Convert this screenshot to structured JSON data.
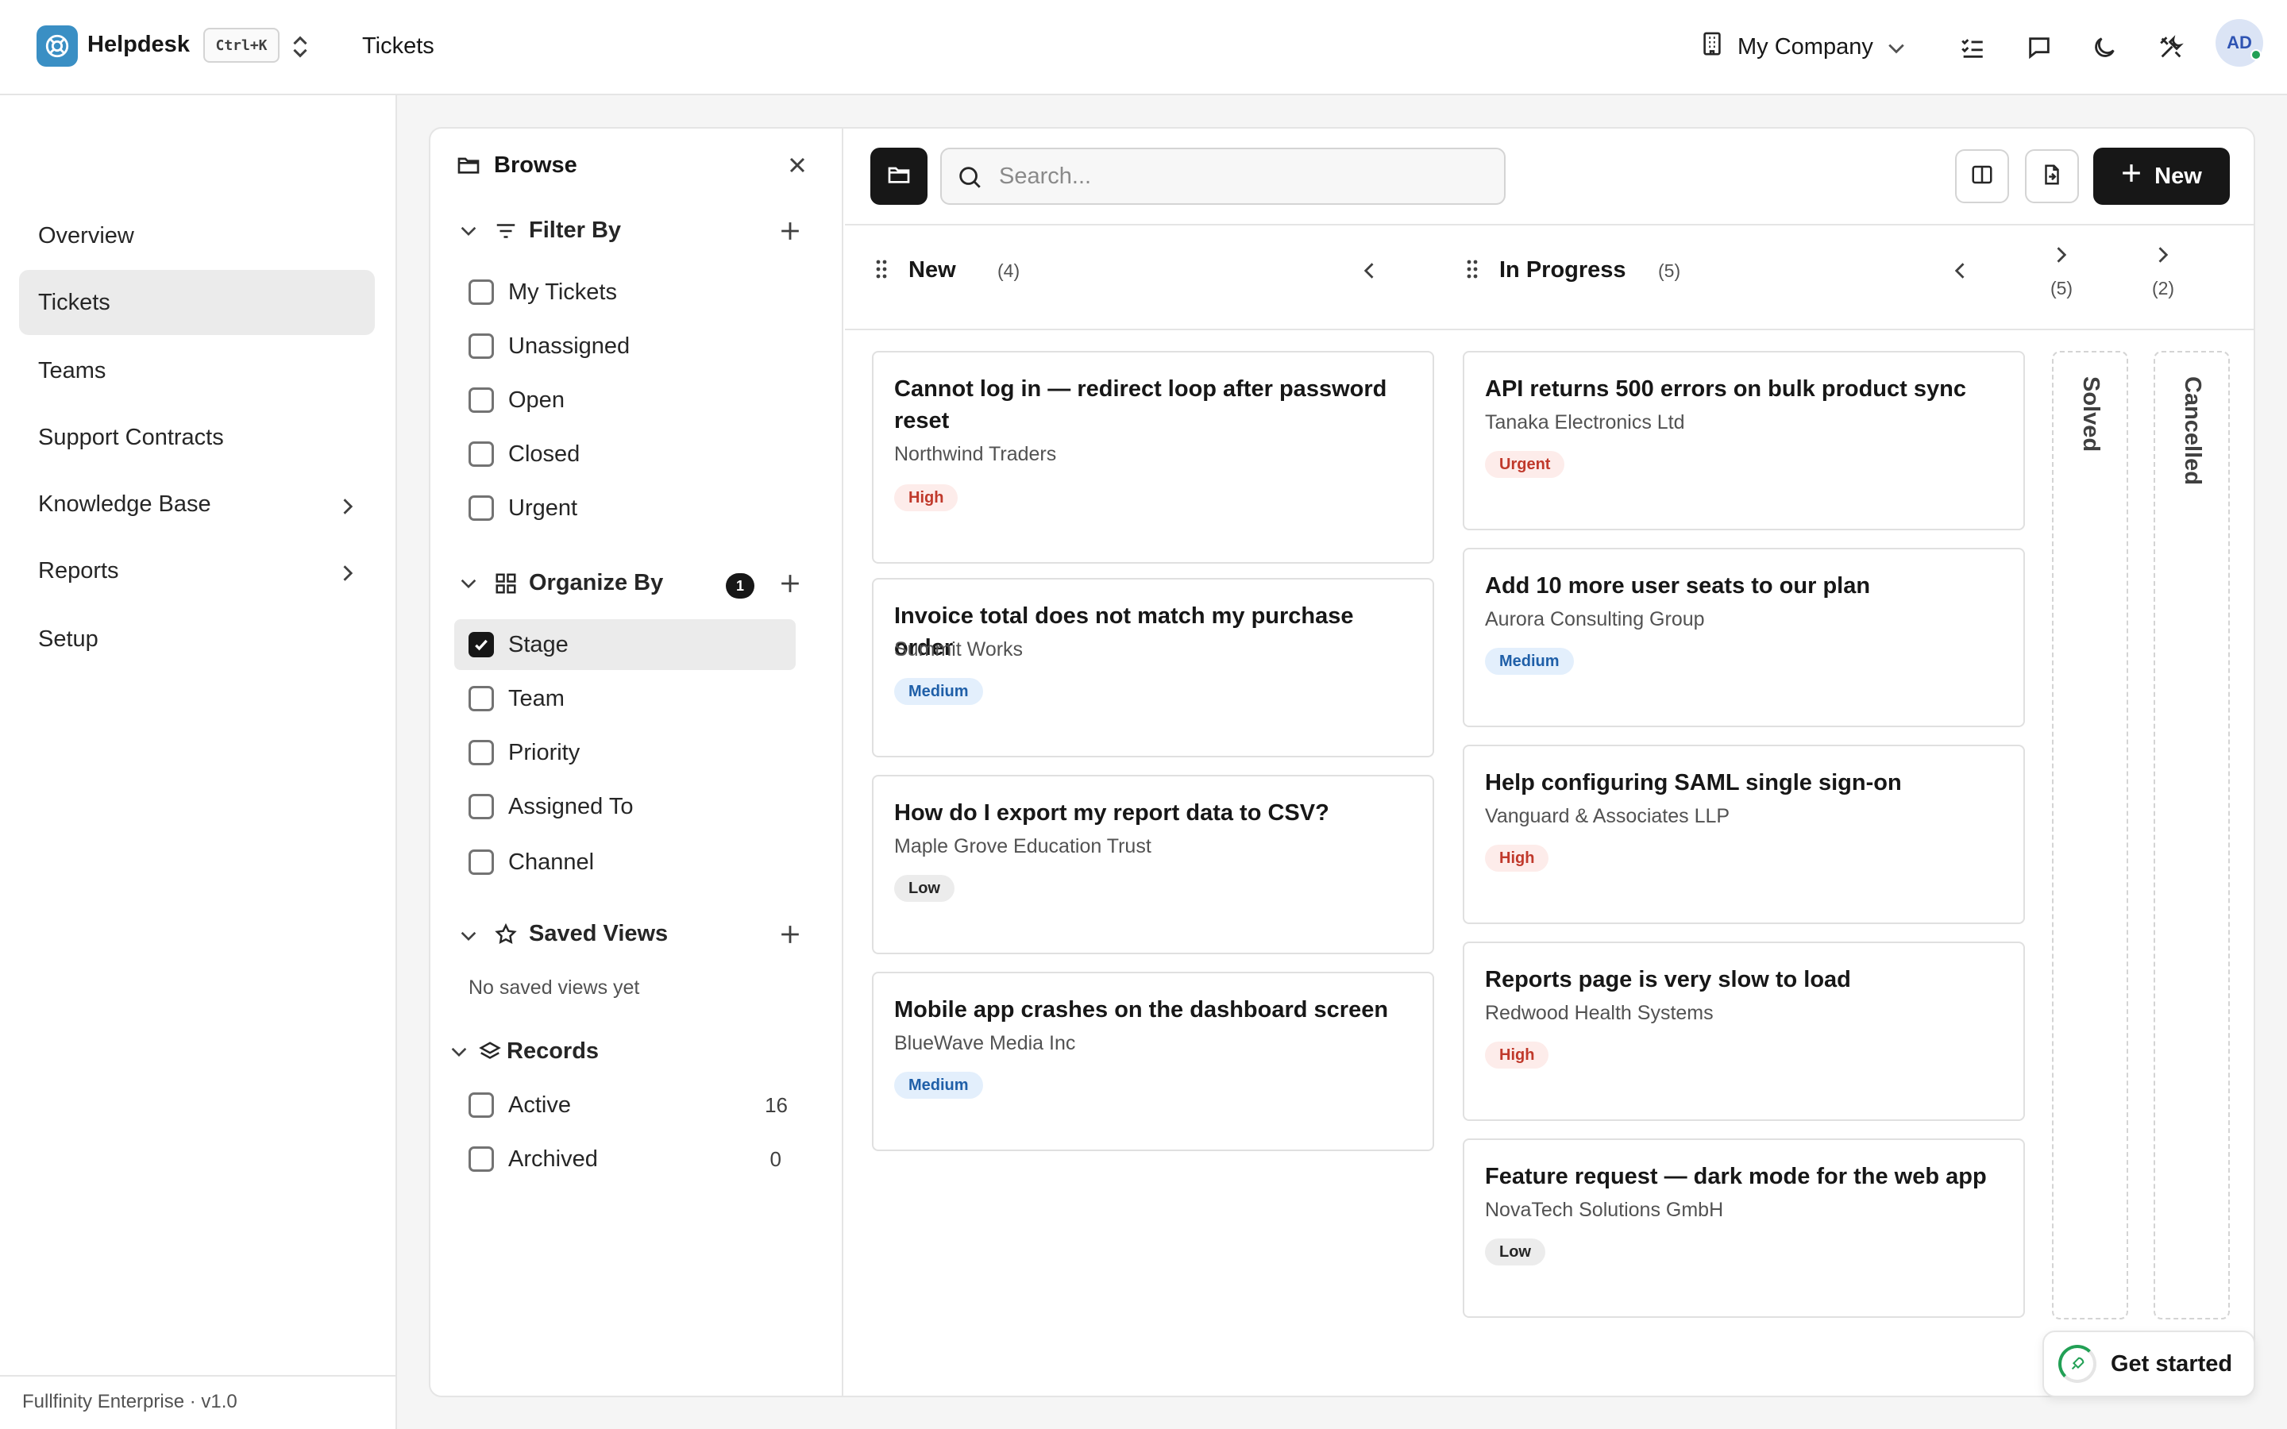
{
  "app": {
    "name": "Helpdesk",
    "shortcut": "Ctrl+K",
    "breadcrumb": "Tickets",
    "company": "My Company",
    "avatar_initials": "AD"
  },
  "sidebar": {
    "items": [
      {
        "label": "Overview"
      },
      {
        "label": "Tickets",
        "active": true
      },
      {
        "label": "Teams"
      },
      {
        "label": "Support Contracts"
      },
      {
        "label": "Knowledge Base"
      },
      {
        "label": "Reports"
      },
      {
        "label": "Setup"
      }
    ],
    "footer": "Fullfinity Enterprise · v1.0"
  },
  "browse": {
    "title": "Browse",
    "filter_by": {
      "title": "Filter By",
      "options": [
        "My Tickets",
        "Unassigned",
        "Open",
        "Closed",
        "Urgent"
      ]
    },
    "organize_by": {
      "title": "Organize By",
      "badge": "1",
      "options": [
        "Stage",
        "Team",
        "Priority",
        "Assigned To",
        "Channel"
      ],
      "selected": "Stage"
    },
    "saved_views": {
      "title": "Saved Views",
      "empty": "No saved views yet"
    },
    "records": {
      "title": "Records",
      "items": [
        {
          "label": "Active",
          "count": "16"
        },
        {
          "label": "Archived",
          "count": "0"
        }
      ]
    }
  },
  "toolbar": {
    "search_placeholder": "Search...",
    "new_label": "New"
  },
  "columns": [
    {
      "title": "New",
      "count": "(4)",
      "cards": [
        {
          "title": "Cannot log in — redirect loop after password reset",
          "org": "Northwind Traders",
          "priority": "High"
        },
        {
          "title": "Invoice total does not match my purchase order",
          "org": "Summit Works",
          "priority": "Medium"
        },
        {
          "title": "How do I export my report data to CSV?",
          "org": "Maple Grove Education Trust",
          "priority": "Low"
        },
        {
          "title": "Mobile app crashes on the dashboard screen",
          "org": "BlueWave Media Inc",
          "priority": "Medium"
        }
      ]
    },
    {
      "title": "In Progress",
      "count": "(5)",
      "cards": [
        {
          "title": "API returns 500 errors on bulk product sync",
          "org": "Tanaka Electronics Ltd",
          "priority": "Urgent"
        },
        {
          "title": "Add 10 more user seats to our plan",
          "org": "Aurora Consulting Group",
          "priority": "Medium"
        },
        {
          "title": "Help configuring SAML single sign-on",
          "org": "Vanguard & Associates LLP",
          "priority": "High"
        },
        {
          "title": "Reports page is very slow to load",
          "org": "Redwood Health Systems",
          "priority": "High"
        },
        {
          "title": "Feature request — dark mode for the web app",
          "org": "NovaTech Solutions GmbH",
          "priority": "Low"
        }
      ]
    },
    {
      "title": "Solved",
      "count": "(5)",
      "collapsed": true
    },
    {
      "title": "Cancelled",
      "count": "(2)",
      "collapsed": true
    }
  ],
  "get_started": "Get started",
  "icons": [
    "lifebuoy-icon",
    "updown-icon",
    "building-icon",
    "chevron-down-icon",
    "checklist-icon",
    "chat-icon",
    "moon-icon",
    "tools-icon",
    "folder-icon",
    "close-icon",
    "filter-icon",
    "plus-icon",
    "grid-icon",
    "star-icon",
    "layers-icon",
    "search-icon",
    "columns-icon",
    "export-icon",
    "drag-handle-icon",
    "chevron-left-icon",
    "chevron-right-icon",
    "rocket-icon"
  ]
}
